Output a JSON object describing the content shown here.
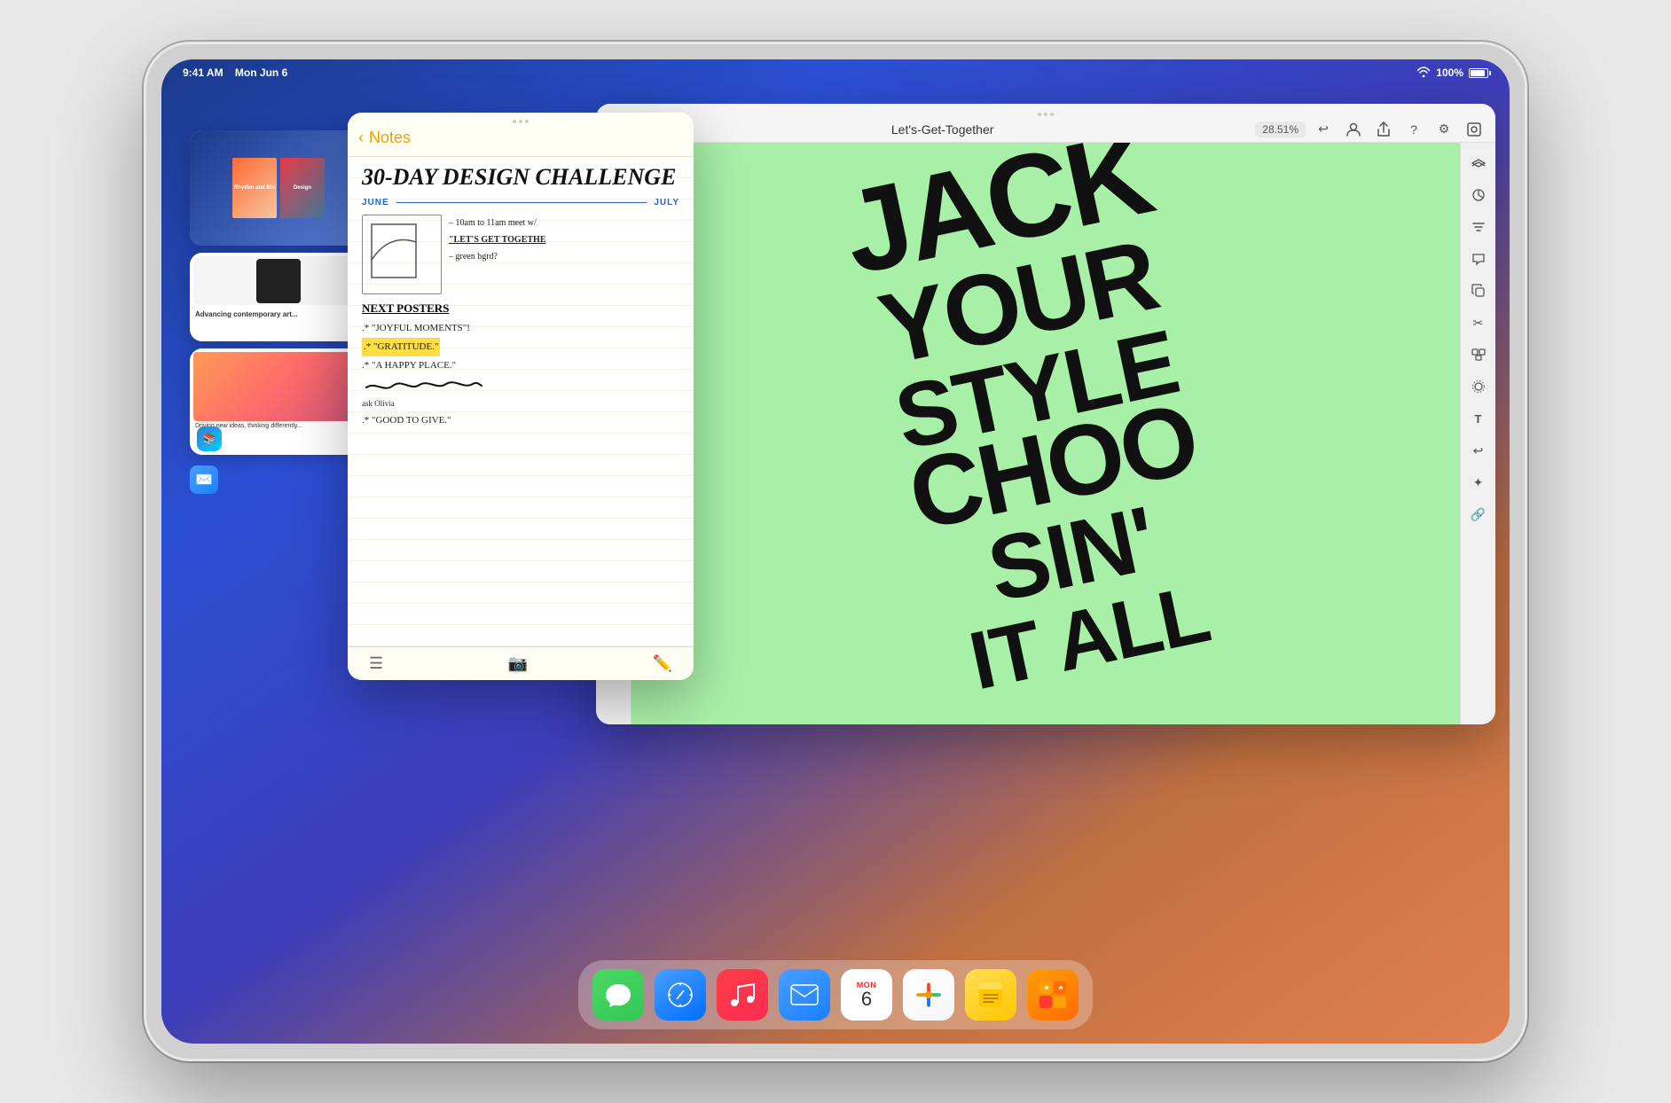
{
  "device": {
    "status_bar": {
      "time": "9:41 AM",
      "date": "Mon Jun 6",
      "wifi": "wifi",
      "battery": "100%"
    }
  },
  "dock": {
    "apps": [
      {
        "id": "messages",
        "label": "Messages",
        "emoji": "💬"
      },
      {
        "id": "safari",
        "label": "Safari",
        "emoji": "🧭"
      },
      {
        "id": "music",
        "label": "Music",
        "emoji": "🎵"
      },
      {
        "id": "mail",
        "label": "Mail",
        "emoji": "✉️"
      },
      {
        "id": "calendar",
        "label": "Calendar",
        "month": "MON",
        "day": "6"
      },
      {
        "id": "photos",
        "label": "Photos",
        "emoji": "🌸"
      },
      {
        "id": "notes",
        "label": "Notes",
        "emoji": "📝"
      },
      {
        "id": "superstar",
        "label": "Superstar",
        "emoji": "⭐"
      }
    ]
  },
  "notes_window": {
    "back_label": "Notes",
    "title": "30-DAY DESIGN CHALLENGE",
    "timeline_start": "JUNE",
    "timeline_end": "JULY",
    "lines": [
      "– 10am to 11am meet w/",
      "\"LET'S GET TOGETHE",
      "– green bgrd?"
    ],
    "section": "NEXT POSTERS",
    "poster_lines": [
      ".* \"JOYFUL MOMENTS\"",
      ".* \"GRATITUDE.\"",
      ".* \"A HAPPY PLACE.\"",
      ".* \"GOOD TO GIVE.\""
    ]
  },
  "procreate_window": {
    "title": "Let's-Get-Together",
    "percentage": "28.51%",
    "canvas_text": "JACK\nYOUR\nSTYLE\nCHOO\nSIN'"
  }
}
